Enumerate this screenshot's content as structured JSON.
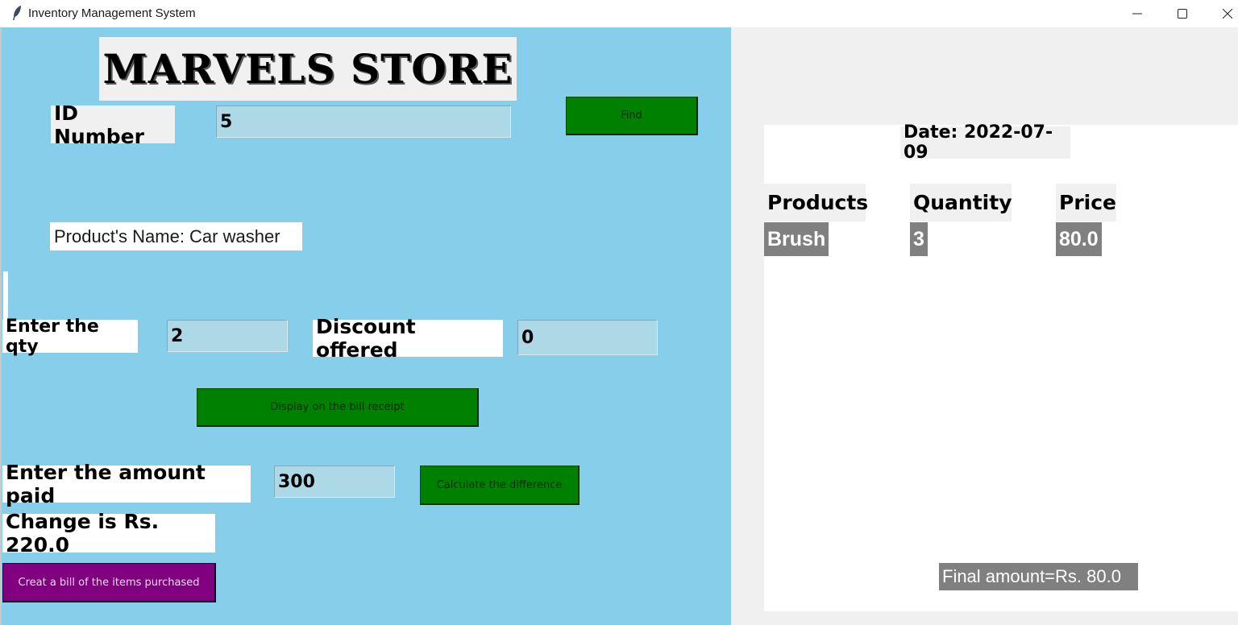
{
  "window": {
    "title": "Inventory Management System",
    "app_icon": "feather-icon",
    "controls": {
      "minimize_icon": "minimize-icon",
      "maximize_icon": "maximize-icon",
      "close_icon": "close-icon"
    }
  },
  "form": {
    "store_title": "MARVELS STORE",
    "id_label": "ID Number",
    "id_value": "5",
    "find_label": "Find",
    "product_name": "Product's Name: Car washer",
    "qty_label": "Enter the qty",
    "qty_value": "2",
    "discount_label": "Discount offered",
    "discount_value": "0",
    "display_button_label": "Display on the bill receipt",
    "amount_label": "Enter the amount paid",
    "amount_value": "300",
    "calc_button_label": "Calculate the difference",
    "change_text": "Change is Rs. 220.0",
    "bill_button_label": "Creat a bill of the items purchased"
  },
  "receipt": {
    "date": "Date: 2022-07-09",
    "columns": [
      "Products",
      "Quantity",
      "Price"
    ],
    "rows": [
      {
        "product": "Brush",
        "quantity": "3",
        "price": "80.0"
      }
    ],
    "final_amount": "Final amount=Rs. 80.0"
  },
  "colors": {
    "left_panel_bg": "#87ceeb",
    "entry_bg": "#add8e6",
    "button_green": "#008000",
    "button_purple": "#800080",
    "receipt_cell_bg": "#808080"
  }
}
